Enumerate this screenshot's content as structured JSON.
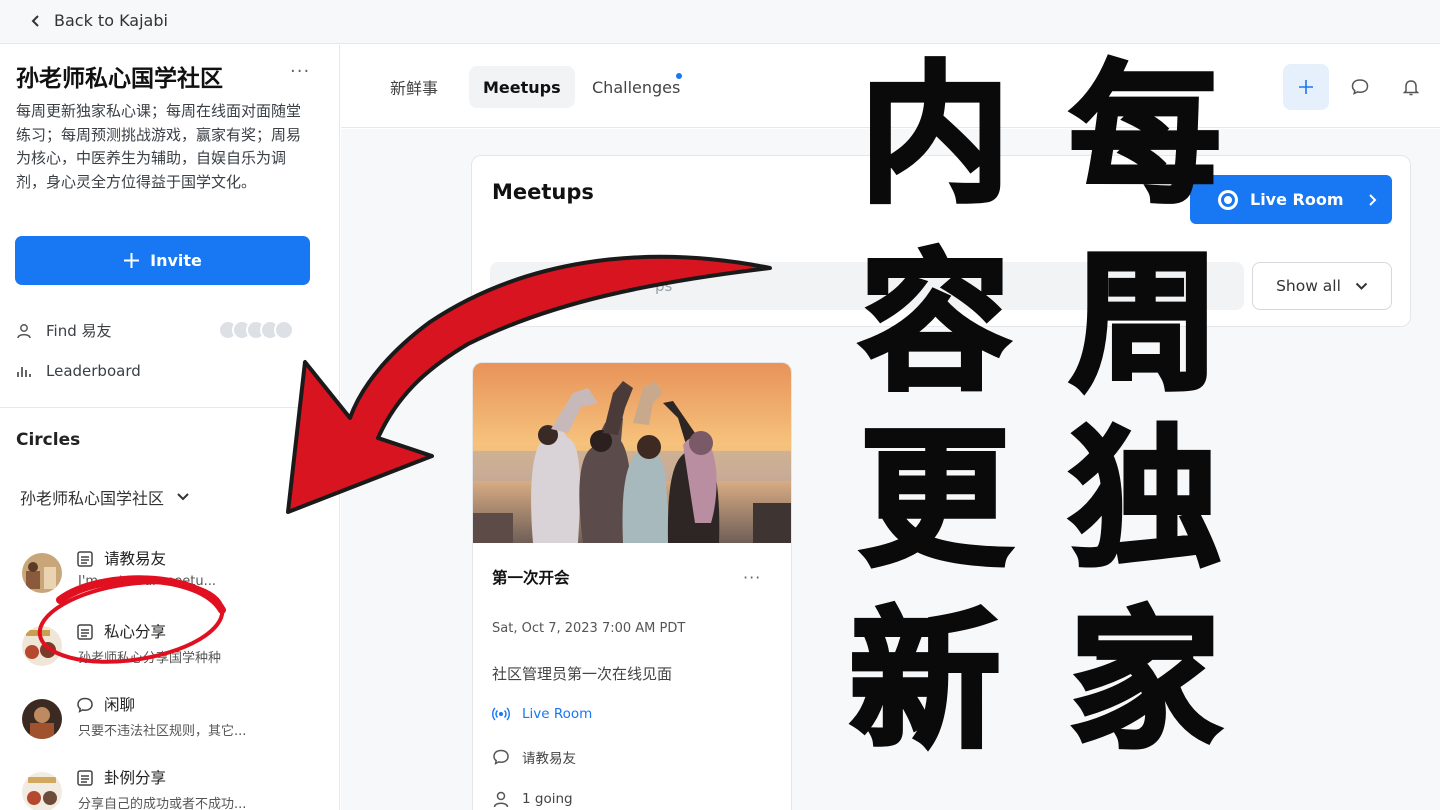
{
  "topbar": {
    "back_label": "Back to Kajabi"
  },
  "sidebar": {
    "community_title": "孙老师私心国学社区",
    "more_label": "···",
    "description": "每周更新独家私心课；每周在线面对面随堂练习；每周预测挑战游戏，赢家有奖；周易为核心，中医养生为辅助，自娱自乐为调剂，身心灵全方位得益于国学文化。",
    "invite_label": "Invite",
    "find_label": "Find 易友",
    "leaderboard_label": "Leaderboard",
    "circles_heading": "Circles",
    "group_name": "孙老师私心国学社区",
    "circles": [
      {
        "name": "请教易友",
        "subtitle": "I'm ... to our meetu..."
      },
      {
        "name": "私心分享",
        "subtitle": "孙老师私心分享国学种种"
      },
      {
        "name": "闲聊",
        "subtitle": "只要不违法社区规则，其它..."
      },
      {
        "name": "卦例分享",
        "subtitle": "分享自己的成功或者不成功..."
      }
    ]
  },
  "header": {
    "tabs": [
      {
        "label": "新鲜事"
      },
      {
        "label": "Meetups"
      },
      {
        "label": "Challenges"
      }
    ]
  },
  "main": {
    "panel_title": "Meetups",
    "live_room_button": "Live Room",
    "search_placeholder": "ps",
    "filter_label": "Show all",
    "meetup": {
      "title": "第一次开会",
      "more_label": "···",
      "date": "Sat, Oct 7, 2023 7:00 AM PDT",
      "description": "社区管理员第一次在线见面",
      "location": "Live Room",
      "circle": "请教易友",
      "going": "1 going"
    }
  },
  "overlay": {
    "chars_left": [
      "内",
      "容",
      "更",
      "新"
    ],
    "chars_right": [
      "每",
      "周",
      "独",
      "家"
    ]
  },
  "colors": {
    "accent": "#1877f2",
    "arrow": "#d7141f",
    "highlight_circle": "#e01020"
  }
}
